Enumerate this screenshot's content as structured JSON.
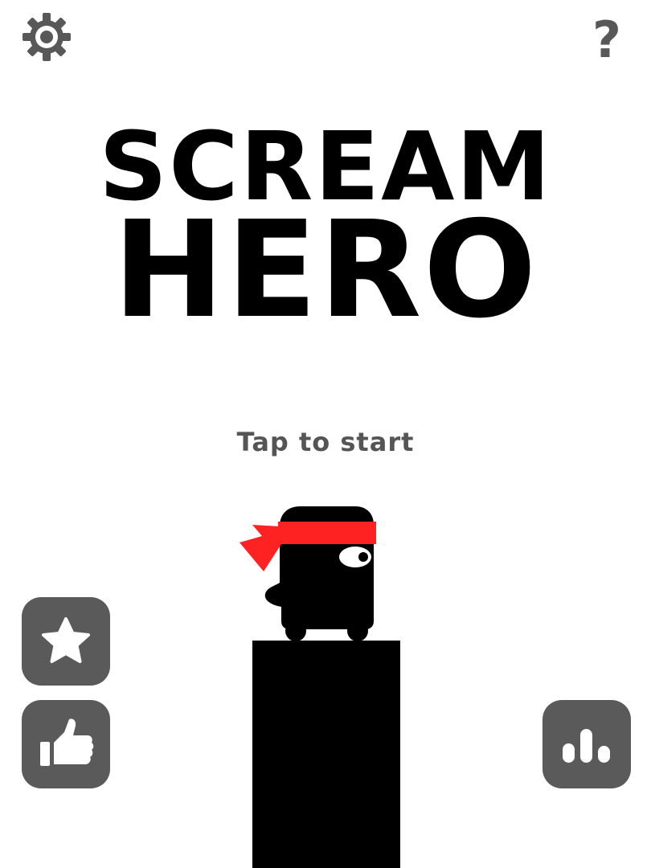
{
  "title": {
    "line1": "SCREAM",
    "line2": "HERO"
  },
  "prompt": {
    "tap_text": "Tap to start"
  },
  "top_bar": {
    "help_label": "?"
  },
  "icons": {
    "settings": "gear-icon",
    "help": "question-mark-icon",
    "rate": "star-icon",
    "like": "thumbs-up-icon",
    "leaderboard": "bar-chart-icon"
  },
  "colors": {
    "background": "#ffffff",
    "title": "#000000",
    "prompt_text": "#555555",
    "button_fill": "#5a5a5a",
    "icon_on_button": "#ffffff",
    "headband": "#ff2222",
    "hero_body": "#000000",
    "pillar": "#000000"
  }
}
